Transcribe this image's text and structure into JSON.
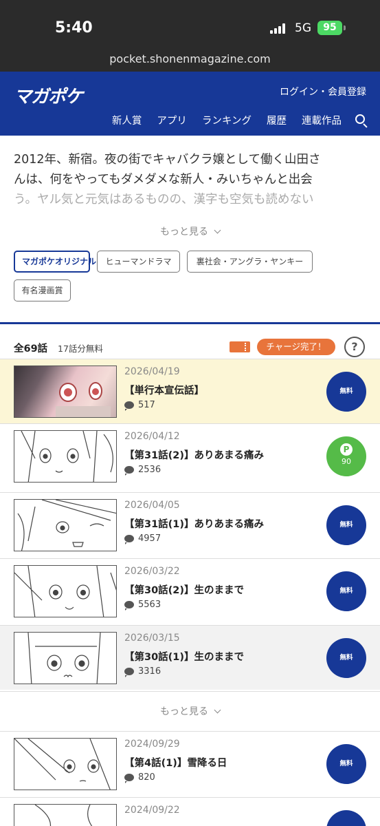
{
  "status_bar": {
    "time": "5:40",
    "network": "5G",
    "battery": "95"
  },
  "browser": {
    "url": "pocket.shonenmagazine.com"
  },
  "header": {
    "logo": "マガポケ",
    "login": "ログイン・会員登録",
    "nav": [
      "新人賞",
      "アプリ",
      "ランキング",
      "履歴",
      "連載作品"
    ]
  },
  "synopsis": {
    "line1": "2012年、新宿。夜の街でキャバクラ嬢として働く山田さ",
    "line2": "んは、何をやってもダメダメな新人・みいちゃんと出会",
    "line3": "う。ヤル気と元気はあるものの、漢字も空気も読めない"
  },
  "more_label": "もっと見る",
  "tags": [
    "マガポケオリジナル",
    "ヒューマンドラマ",
    "裏社会・アングラ・ヤンキー",
    "有名漫画賞"
  ],
  "list_header": {
    "total": "全69話",
    "free": "17話分無料",
    "charge": "チャージ完了！",
    "help": "?"
  },
  "episodes": [
    {
      "date": "2026/04/19",
      "title": "【単行本宣伝話】",
      "comments": "517",
      "button": "無料"
    },
    {
      "date": "2026/04/12",
      "title": "【第31話(2)】ありあまる痛み",
      "comments": "2536",
      "button": "P",
      "price": "90"
    },
    {
      "date": "2026/04/05",
      "title": "【第31話(1)】ありあまる痛み",
      "comments": "4957",
      "button": "無料"
    },
    {
      "date": "2026/03/22",
      "title": "【第30話(2)】生のままで",
      "comments": "5563",
      "button": "無料"
    },
    {
      "date": "2026/03/15",
      "title": "【第30話(1)】生のままで",
      "comments": "3316",
      "button": "無料"
    },
    {
      "date": "2024/09/29",
      "title": "【第4話(1)】雪降る日",
      "comments": "820",
      "button": "無料"
    },
    {
      "date": "2024/09/22",
      "title": "",
      "comments": "",
      "button": ""
    }
  ],
  "colors": {
    "brand": "#173897",
    "charge": "#e8743b",
    "point": "#55bb48",
    "highlight": "#fcf6d6"
  }
}
